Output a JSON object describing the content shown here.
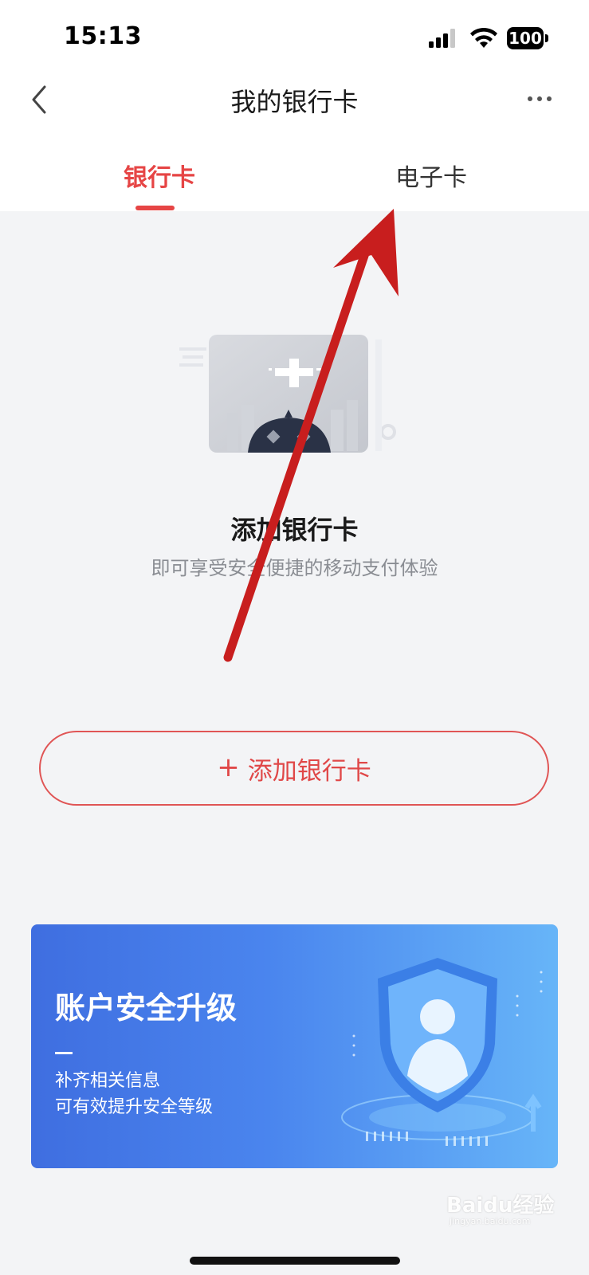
{
  "status_bar": {
    "time": "15:13",
    "battery": "100"
  },
  "nav": {
    "title": "我的银行卡"
  },
  "tabs": [
    {
      "label": "银行卡",
      "active": true
    },
    {
      "label": "电子卡",
      "active": false
    }
  ],
  "empty_state": {
    "title": "添加银行卡",
    "subtitle": "即可享受安全便捷的移动支付体验"
  },
  "add_button": {
    "icon": "+",
    "label": "添加银行卡"
  },
  "banner": {
    "title": "账户安全升级",
    "line1": "补齐相关信息",
    "line2": "可有效提升安全等级"
  },
  "watermark": {
    "text": "Baidu经验",
    "sub": "jingyan.baidu.com"
  },
  "colors": {
    "accent": "#e64545",
    "background": "#f3f4f6",
    "banner_start": "#3f6ee0",
    "banner_end": "#67b5f8",
    "annotation_arrow": "#c81e1e"
  }
}
